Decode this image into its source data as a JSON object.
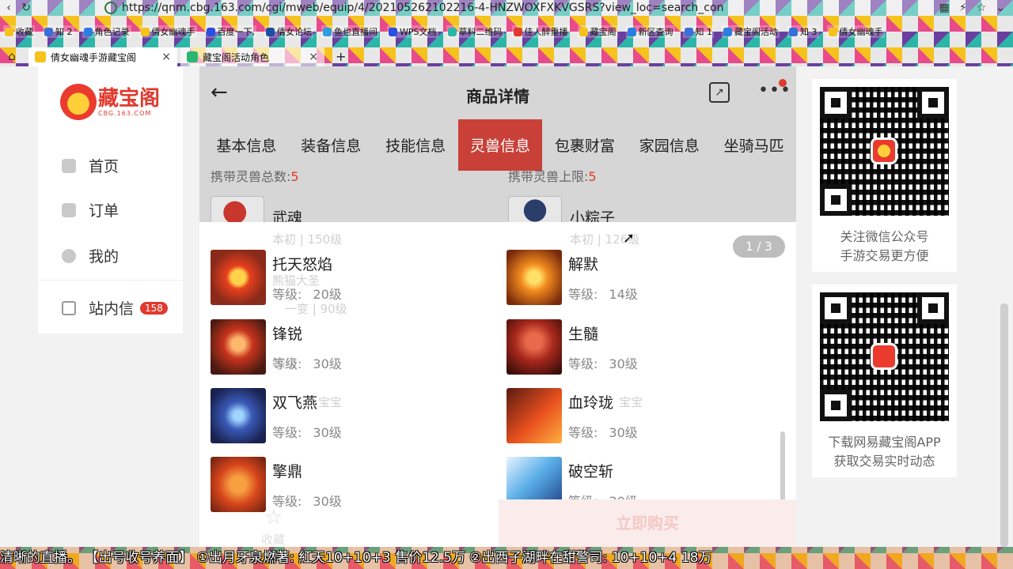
{
  "browser": {
    "url": "https://qnm.cbg.163.com/cgi/mweb/equip/4/202105262102216-4-HNZWOXFXKVGSRS?view_loc=search_cond",
    "bookmarks": [
      "收藏",
      "知 2",
      "角色记录",
      "倩女幽魂手",
      "百度一下,",
      "倩女论坛",
      "鱼也直播间",
      "WPS文档",
      "草料二维码",
      "佳人醉重播",
      "藏宝阁",
      "新区查询",
      "知 1",
      "藏宝阁活动",
      "知 3",
      "倩女幽魂手"
    ],
    "tabs": [
      {
        "title": "倩女幽魂手游藏宝阁",
        "active": true
      },
      {
        "title": "藏宝阁活动角色",
        "active": false
      }
    ],
    "new_tab": "+"
  },
  "sidebar": {
    "logo_text": "藏宝阁",
    "logo_sub": "CBG.163.COM",
    "items": [
      {
        "label": "首页",
        "icon": "home-icon"
      },
      {
        "label": "订单",
        "icon": "order-icon"
      },
      {
        "label": "我的",
        "icon": "user-icon"
      },
      {
        "label": "站内信",
        "icon": "mail-icon",
        "badge": "158"
      }
    ]
  },
  "header": {
    "title": "商品详情"
  },
  "tabs": [
    "基本信息",
    "装备信息",
    "技能信息",
    "灵兽信息",
    "包裹财富",
    "家园信息",
    "坐骑马匹"
  ],
  "active_tab": "灵兽信息",
  "strip": {
    "left_label": "携带灵兽总数:",
    "left_value": "5",
    "right_label": "携带灵兽上限:",
    "right_value": "5",
    "left_pet": "武魂",
    "right_pet": "小粽子"
  },
  "pager": "1 / 3",
  "faint_texts": [
    "本初 | 150级",
    "本初 | 126级",
    "熊猫大圣",
    "一变 | 90级",
    "宝宝",
    "宝宝",
    "宝宝"
  ],
  "skills_left": [
    {
      "name": "托天怒焰",
      "level_label": "等级:",
      "level": "20级"
    },
    {
      "name": "锋锐",
      "level_label": "等级:",
      "level": "30级"
    },
    {
      "name": "双飞燕",
      "level_label": "等级:",
      "level": "30级"
    },
    {
      "name": "擎鼎",
      "level_label": "等级:",
      "level": "30级"
    }
  ],
  "skills_right": [
    {
      "name": "解默",
      "level_label": "等级:",
      "level": "14级"
    },
    {
      "name": "生髓",
      "level_label": "等级:",
      "level": "30级"
    },
    {
      "name": "血玲珑",
      "level_label": "等级:",
      "level": "30级"
    },
    {
      "name": "破空斩",
      "level_label": "等级:",
      "level": "30级"
    }
  ],
  "buy_button": "立即购买",
  "favorite_label": "收藏",
  "qr_cards": [
    {
      "line1": "关注微信公众号",
      "line2": "手游交易更方便"
    },
    {
      "line1": "下载网易藏宝阁APP",
      "line2": "获取交易实时动态"
    }
  ],
  "ticker": "清晰的直播。   【出号收号养面】 ①出月牙泉燃著: 紅天10+10+3  售价12.5万      ②出西子湖畔在甜警司: 10+10+4  18万",
  "colors": {
    "brand_red": "#e0392d",
    "active_tab_bg": "#c84038",
    "header_gray": "#d6d6d6"
  }
}
